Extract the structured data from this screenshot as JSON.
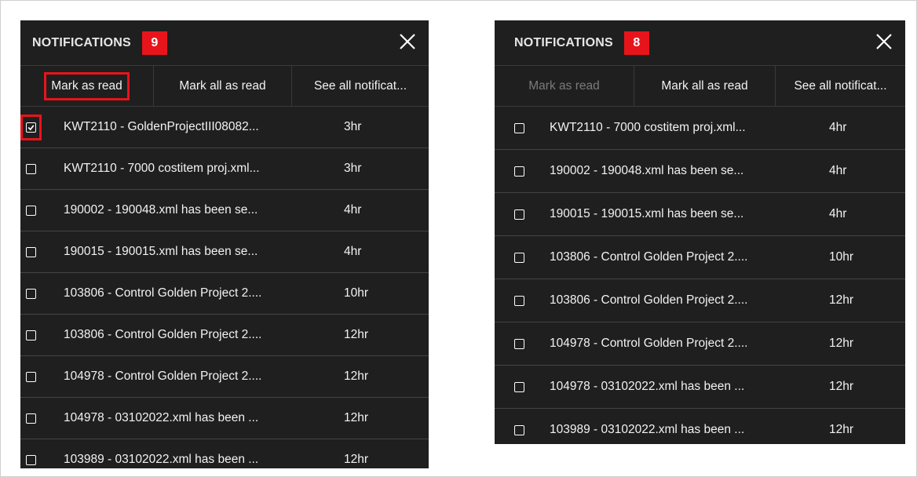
{
  "colors": {
    "panel_bg": "#1f1f1f",
    "badge_bg": "#e8141c",
    "highlight": "#e8141c",
    "text": "#f2f2f2",
    "disabled_text": "#7b7b7b"
  },
  "panels": [
    {
      "title": "NOTIFICATIONS",
      "badge": "9",
      "close_icon": "close-icon",
      "toolbar": {
        "mark_as_read": "Mark as read",
        "mark_all_as_read": "Mark all as read",
        "see_all": "See all notificat..."
      },
      "items": [
        {
          "text": "KWT2110 - GoldenProjectIII08082...",
          "time": "3hr",
          "checked": true
        },
        {
          "text": "KWT2110 - 7000 costitem proj.xml...",
          "time": "3hr",
          "checked": false
        },
        {
          "text": "190002 - 190048.xml has been se...",
          "time": "4hr",
          "checked": false
        },
        {
          "text": "190015 - 190015.xml has been se...",
          "time": "4hr",
          "checked": false
        },
        {
          "text": "103806 - Control Golden Project 2....",
          "time": "10hr",
          "checked": false
        },
        {
          "text": "103806 - Control Golden Project 2....",
          "time": "12hr",
          "checked": false
        },
        {
          "text": "104978 - Control Golden Project 2....",
          "time": "12hr",
          "checked": false
        },
        {
          "text": "104978 - 03102022.xml has been ...",
          "time": "12hr",
          "checked": false
        },
        {
          "text": "103989 - 03102022.xml has been ...",
          "time": "12hr",
          "checked": false
        }
      ]
    },
    {
      "title": "NOTIFICATIONS",
      "badge": "8",
      "close_icon": "close-icon",
      "toolbar": {
        "mark_as_read": "Mark as read",
        "mark_all_as_read": "Mark all as read",
        "see_all": "See all notificat..."
      },
      "items": [
        {
          "text": "KWT2110 - 7000 costitem proj.xml...",
          "time": "4hr",
          "checked": false
        },
        {
          "text": "190002 - 190048.xml has been se...",
          "time": "4hr",
          "checked": false
        },
        {
          "text": "190015 - 190015.xml has been se...",
          "time": "4hr",
          "checked": false
        },
        {
          "text": "103806 - Control Golden Project 2....",
          "time": "10hr",
          "checked": false
        },
        {
          "text": "103806 - Control Golden Project 2....",
          "time": "12hr",
          "checked": false
        },
        {
          "text": "104978 - Control Golden Project 2....",
          "time": "12hr",
          "checked": false
        },
        {
          "text": "104978 - 03102022.xml has been ...",
          "time": "12hr",
          "checked": false
        },
        {
          "text": "103989 - 03102022.xml has been ...",
          "time": "12hr",
          "checked": false
        }
      ]
    }
  ]
}
